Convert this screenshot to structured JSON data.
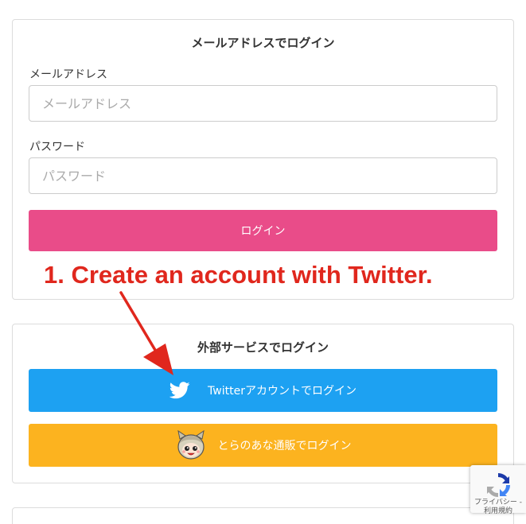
{
  "email_login": {
    "title": "メールアドレスでログイン",
    "email_label": "メールアドレス",
    "email_placeholder": "メールアドレス",
    "email_value": "",
    "password_label": "パスワード",
    "password_placeholder": "パスワード",
    "password_value": "",
    "login_button": "ログイン"
  },
  "external_login": {
    "title": "外部サービスでログイン",
    "twitter_button": "Twitterアカウントでログイン",
    "toranoana_button": "とらのあな通販でログイン"
  },
  "annotation": {
    "text": "1. Create an account with Twitter."
  },
  "recaptcha": {
    "privacy_label": "プライバシー",
    "terms_label": "利用規約",
    "separator": "-"
  },
  "colors": {
    "login_button": "#e94c89",
    "twitter_button": "#1da1f2",
    "toranoana_button": "#fcb31f",
    "annotation": "#e0271d"
  },
  "icons": {
    "twitter": "twitter-bird-icon",
    "toranoana": "toranoana-mascot-icon",
    "recaptcha": "recaptcha-logo-icon"
  }
}
